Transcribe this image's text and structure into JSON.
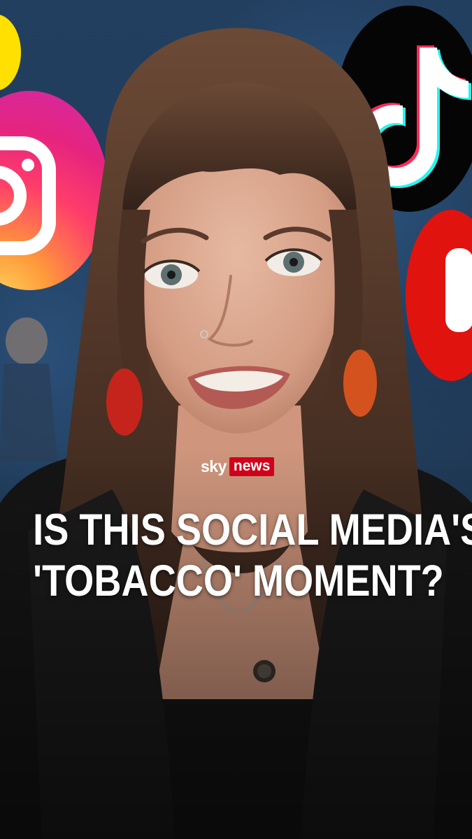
{
  "brand": {
    "sky": "sky",
    "news": "news",
    "colors": {
      "news_background": "#d0021b",
      "text": "#ffffff"
    }
  },
  "headline": {
    "line1": "IS THIS SOCIAL MEDIA'S",
    "line2": "'TOBACCO' MOMENT?"
  },
  "background_logos": [
    "snapchat-logo",
    "instagram-logo",
    "tiktok-logo",
    "youtube-logo"
  ]
}
